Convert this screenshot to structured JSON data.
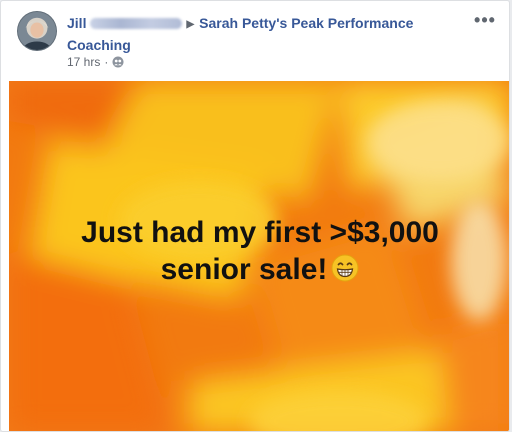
{
  "post": {
    "author_name": "Jill",
    "group_name": "Sarah Petty's Peak Performance Coaching",
    "timestamp": "17 hrs",
    "separator": "·",
    "privacy_icon": "group-members-icon",
    "more_label": "•••",
    "text_line1": "Just had my first >$3,000",
    "text_line2": "senior sale!",
    "emoji": "grinning-face-icon"
  },
  "colors": {
    "link": "#385898",
    "background_orange": "#f27a10",
    "background_yellow": "#f8c21c"
  }
}
